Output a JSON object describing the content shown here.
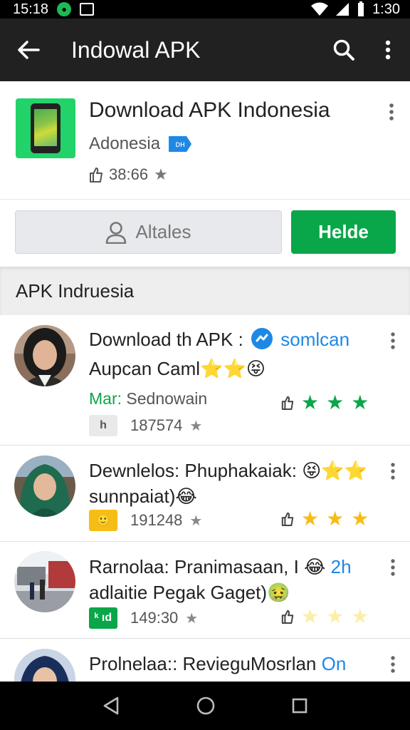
{
  "status_bar": {
    "time": "15:18",
    "clock": "1:30"
  },
  "toolbar": {
    "title": "Indowal APK"
  },
  "app": {
    "title": "Download APK Indonesia",
    "developer": "Adonesia",
    "dev_badge": "ᴅʜ",
    "count": "38:66"
  },
  "actions": {
    "secondary_label": "Altales",
    "primary_label": "Ηelde"
  },
  "section": {
    "title": "APK Indruesia"
  },
  "items": [
    {
      "line1_text": "Download th APK :",
      "line1_accent": "somlcan",
      "line2": "Aupcan Caml⭐⭐😝",
      "meta_label": "Mar:",
      "meta_value": "Sednowain",
      "badge": "h",
      "count": "187574",
      "stars_color": "#0aa64a"
    },
    {
      "line1_text": "Dewnlelos: Phuphakaiak: 😝⭐⭐",
      "line2": "sunnpaiat)😂",
      "badge": "🙂",
      "count": "191248",
      "stars_color": "#f6bd16"
    },
    {
      "line1_text": "Rarnolaa: Pranimasaan, I 😂",
      "line1_accent": "2h",
      "line2": "adlaitie Pegak Gaget)🤢",
      "badge": "ᵏ ıd",
      "count": "149:30",
      "stars_color": "#fbeea8"
    },
    {
      "line1_text": "Prolnelaa:: RevieguMosrlan",
      "line1_accent": "On"
    }
  ]
}
